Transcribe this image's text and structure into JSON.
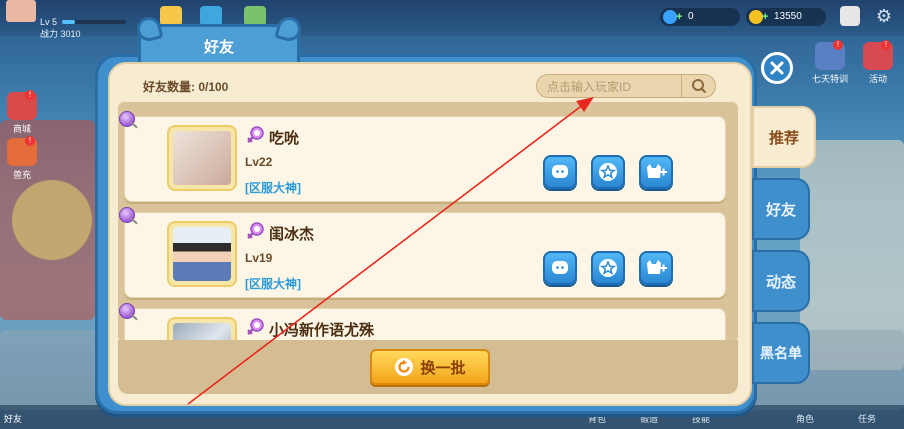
{
  "player": {
    "level": "Lv 5",
    "power": "战力 3010",
    "xp_fraction": 0.2
  },
  "resources": [
    {
      "name": "diamond",
      "value": "0",
      "color": "#39a3ff"
    },
    {
      "name": "gold-coin",
      "value": "13550",
      "color": "#f4c221"
    }
  ],
  "left_menu": [
    {
      "label": "商城"
    },
    {
      "label": "兽充"
    }
  ],
  "right_menu": [
    {
      "label": "七天特训"
    },
    {
      "label": "活动"
    }
  ],
  "bottom_nav": {
    "friends": "好友",
    "items": [
      "背包",
      "锻造",
      "技能",
      "角色",
      "任务"
    ]
  },
  "dialog": {
    "title": "好友",
    "friend_count": "好友数量: 0/100",
    "search_placeholder": "点击输入玩家ID",
    "refresh_label": "换一批"
  },
  "side_tabs": [
    {
      "label": "推荐",
      "active": true
    },
    {
      "label": "好友",
      "active": false
    },
    {
      "label": "动态",
      "active": false
    },
    {
      "label": "黑名单",
      "active": false
    }
  ],
  "friends": [
    {
      "name": "吃吮",
      "level": "Lv22",
      "server": "[区服大神]",
      "gender": "female"
    },
    {
      "name": "闺冰杰",
      "level": "Lv19",
      "server": "[区服大神]",
      "gender": "female"
    },
    {
      "name": "小冯新作语尤殊",
      "level": "",
      "server": "",
      "gender": "female"
    }
  ],
  "colors": {
    "accent_blue": "#3f8fcc",
    "panel_bg": "#f7ecd2",
    "button_orange": "#f4a51b",
    "server_text": "#2a9bd8",
    "annotation_arrow": "#e8281e"
  }
}
